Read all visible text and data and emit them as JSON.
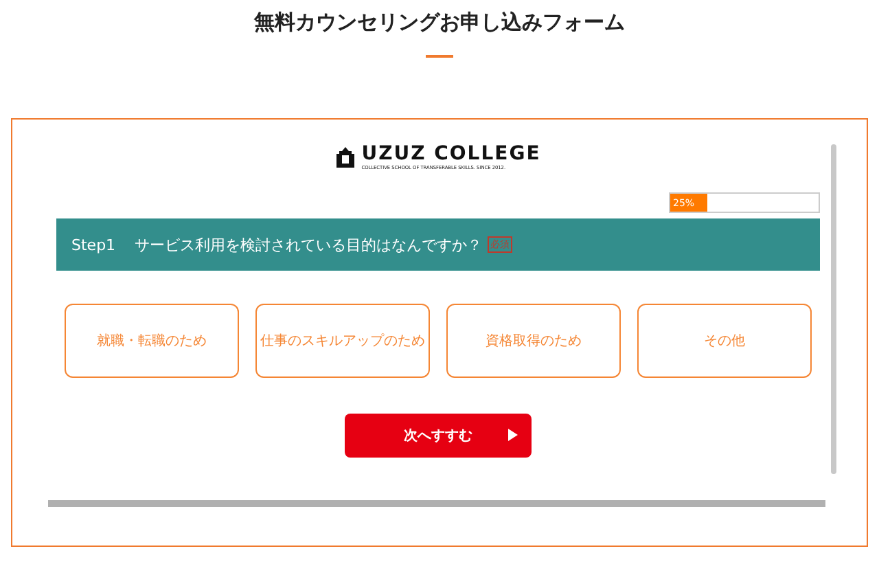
{
  "page_title": "無料カウンセリングお申し込みフォーム",
  "form": {
    "logo": {
      "name": "UZUZ COLLEGE",
      "tagline": "COLLECTIVE SCHOOL OF TRANSFERABLE SKILLS. SINCE 2012."
    },
    "progress": {
      "level": 0.25,
      "label": "25%"
    },
    "question": {
      "step": "Step1",
      "text": "サービス利用を検討されている目的はなんですか？",
      "required_badge": "必須"
    },
    "options": [
      {
        "label": "就職・転職のため",
        "selected": false
      },
      {
        "label": "仕事のスキルアップのため",
        "selected": false
      },
      {
        "label": "資格取得のため",
        "selected": false
      },
      {
        "label": "その他",
        "selected": false
      }
    ],
    "next_button": "次へすすむ"
  }
}
